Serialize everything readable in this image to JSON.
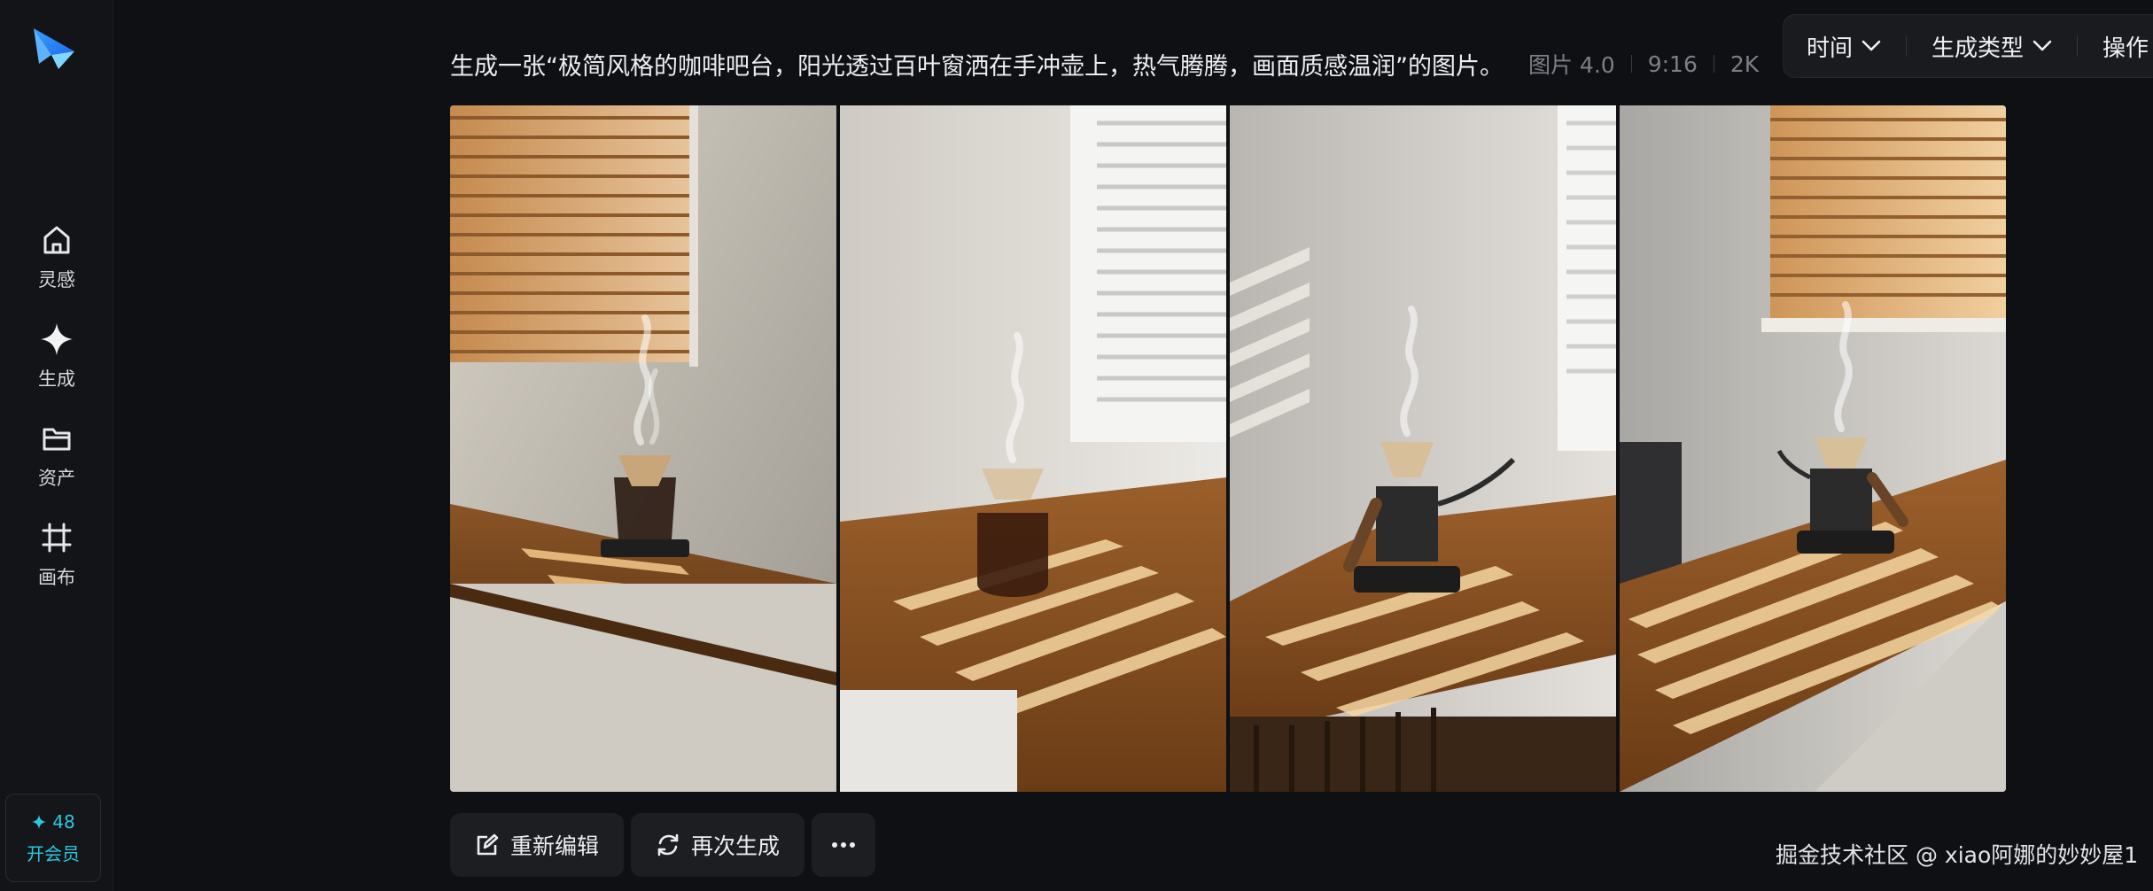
{
  "sidebar": {
    "logo_icon": "paper-plane-logo",
    "items": [
      {
        "label": "灵感",
        "icon": "home-icon"
      },
      {
        "label": "生成",
        "icon": "sparkle-icon"
      },
      {
        "label": "资产",
        "icon": "folder-icon"
      },
      {
        "label": "画布",
        "icon": "crop-icon"
      }
    ],
    "credits": "48",
    "vip_label": "开会员"
  },
  "prompt": {
    "text": "生成一张“极简风格的咖啡吧台，阳光透过百叶窗洒在手冲壶上，热气腾腾，画面质感温润”的图片。",
    "model": "图片 4.0",
    "ratio": "9:16",
    "resolution": "2K"
  },
  "toolbar": {
    "time_label": "时间",
    "type_label": "生成类型",
    "ops_label": "操作"
  },
  "gallery": {
    "images": [
      {
        "alt": "coffee bar image 1"
      },
      {
        "alt": "coffee bar image 2"
      },
      {
        "alt": "coffee bar image 3"
      },
      {
        "alt": "coffee bar image 4"
      }
    ]
  },
  "actions": {
    "reedit_label": "重新编辑",
    "regenerate_label": "再次生成",
    "more_label": "···"
  },
  "watermark": "掘金技术社区 @ xiao阿娜的妙妙屋1",
  "colors": {
    "accent": "#2bc7e0",
    "background": "#0f1013",
    "panel": "#1a1b1f"
  }
}
